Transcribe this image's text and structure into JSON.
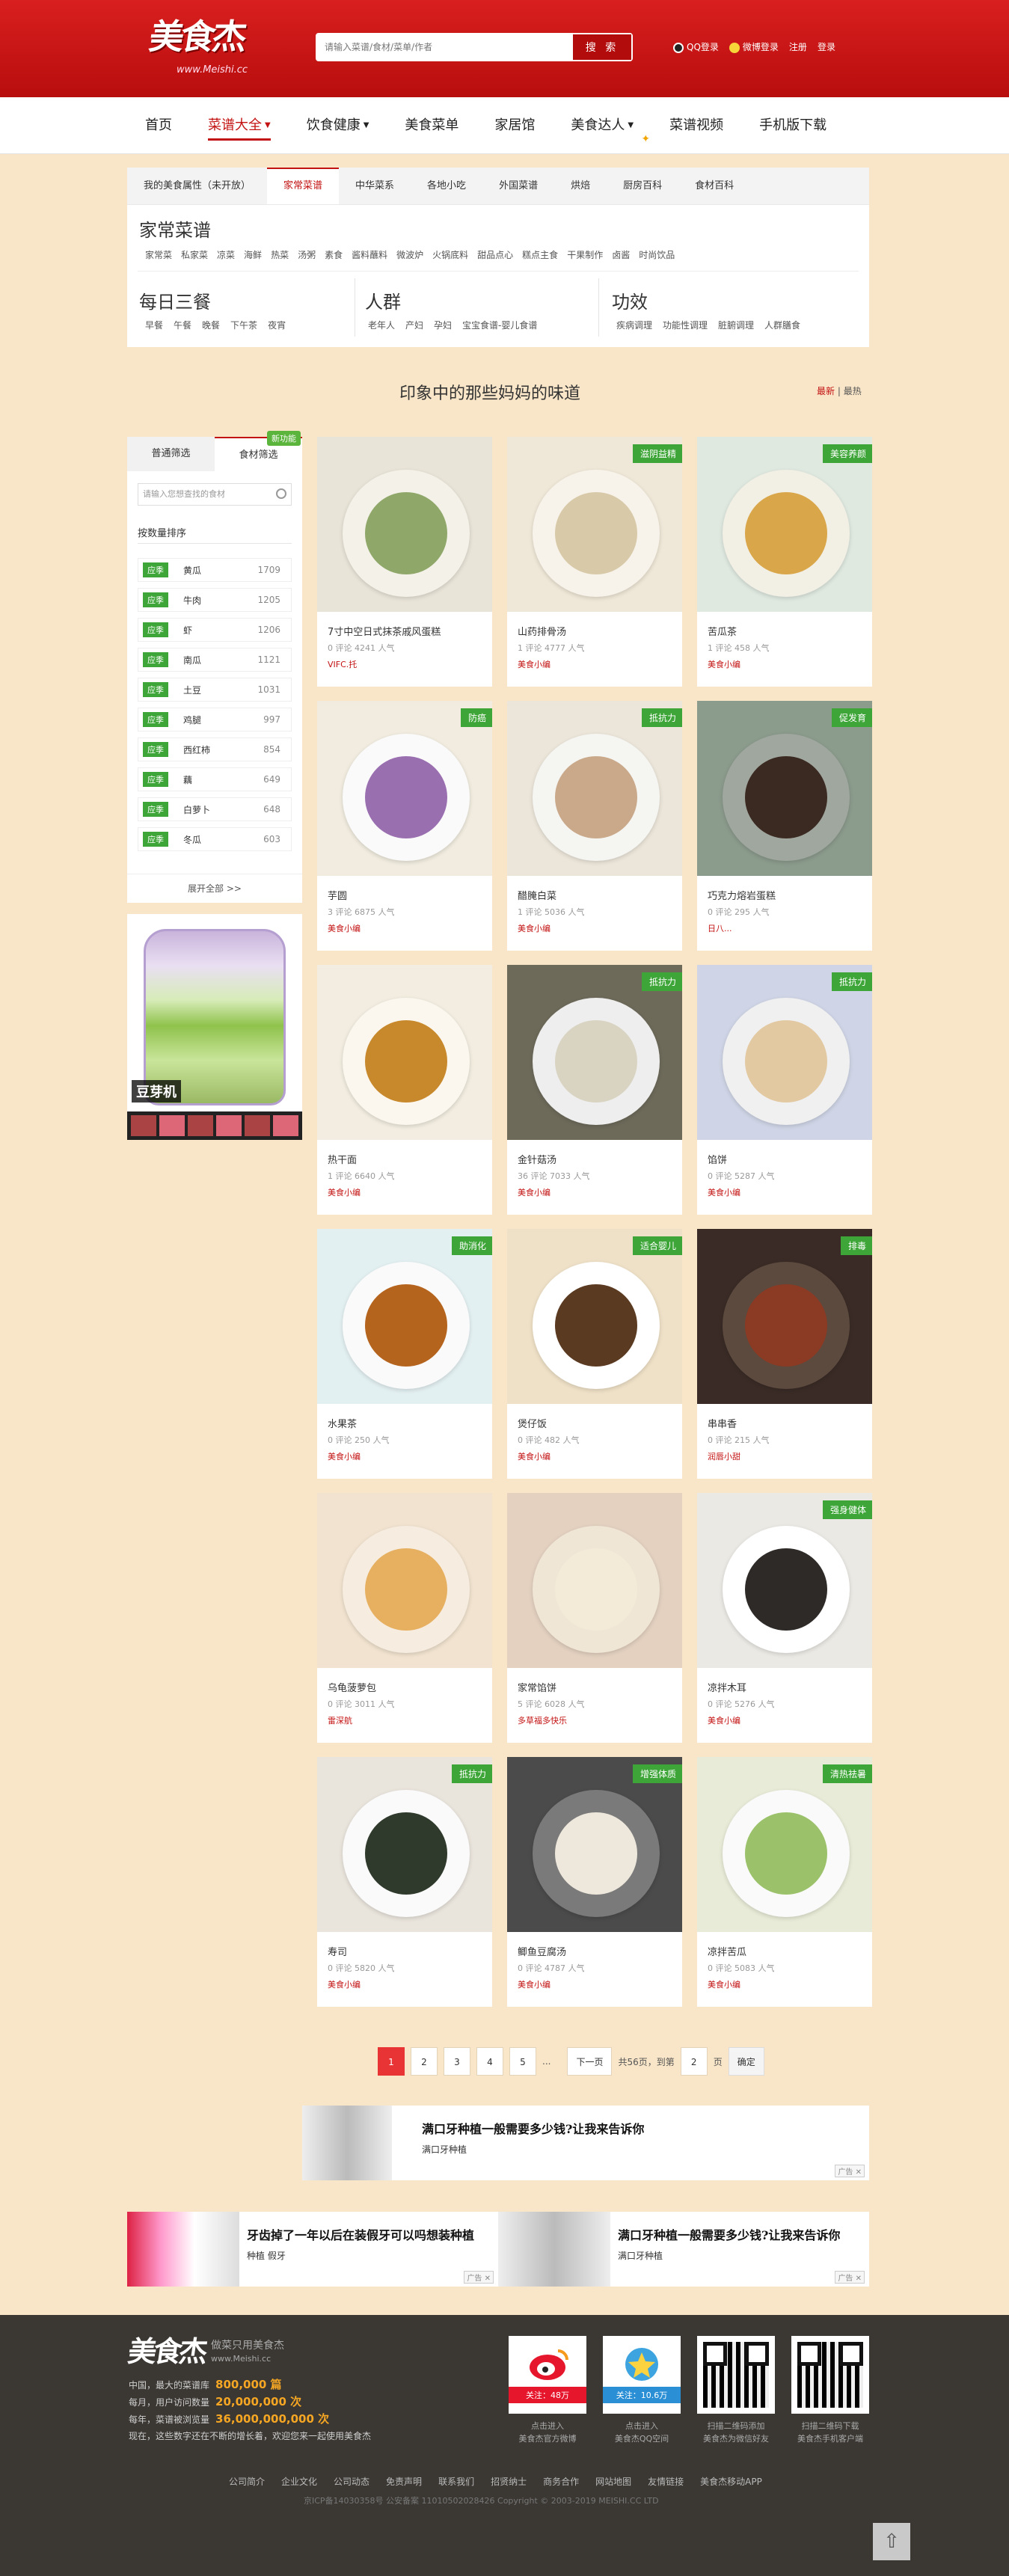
{
  "header": {
    "logo_text": "美食杰",
    "logo_url": "www.Meishi.cc",
    "search_placeholder": "请输入菜谱/食材/菜单/作者",
    "search_button": "搜 索",
    "links": [
      "QQ登录",
      "微博登录",
      "注册",
      "登录"
    ]
  },
  "nav": {
    "items": [
      "首页",
      "菜谱大全",
      "饮食健康",
      "美食菜单",
      "家居馆",
      "美食达人",
      "菜谱视频",
      "手机版下载"
    ],
    "active_index": 1
  },
  "category": {
    "tabs": [
      "我的美食属性（未开放）",
      "家常菜谱",
      "中华菜系",
      "各地小吃",
      "外国菜谱",
      "烘焙",
      "厨房百科",
      "食材百科"
    ],
    "active_tab": 1,
    "home_title": "家常菜谱",
    "home_links": [
      "家常菜",
      "私家菜",
      "凉菜",
      "海鲜",
      "热菜",
      "汤粥",
      "素食",
      "酱料蘸料",
      "微波炉",
      "火锅底料",
      "甜品点心",
      "糕点主食",
      "干果制作",
      "卤酱",
      "时尚饮品"
    ],
    "meal_title": "每日三餐",
    "meal_links": [
      "早餐",
      "午餐",
      "晚餐",
      "下午茶",
      "夜宵"
    ],
    "crowd_title": "人群",
    "crowd_links": [
      "老年人",
      "产妇",
      "孕妇",
      "宝宝食谱-婴儿食谱"
    ],
    "effect_title": "功效",
    "effect_links": [
      "疾病调理",
      "功能性调理",
      "脏腑调理",
      "人群膳食"
    ]
  },
  "section": {
    "title": "印象中的那些妈妈的味道",
    "sort_hot": "最新",
    "sort_sep": "|",
    "sort_other": "最热"
  },
  "sidebar": {
    "tabs": [
      "普通筛选",
      "食材筛选"
    ],
    "new_badge": "新功能",
    "search_placeholder": "请输入您想查找的食材",
    "sort_label": "按数量排序",
    "tag": "应季",
    "ingredients": [
      {
        "name": "黄瓜",
        "count": "1709"
      },
      {
        "name": "牛肉",
        "count": "1205"
      },
      {
        "name": "虾",
        "count": "1206"
      },
      {
        "name": "南瓜",
        "count": "1121"
      },
      {
        "name": "土豆",
        "count": "1031"
      },
      {
        "name": "鸡腿",
        "count": "997"
      },
      {
        "name": "西红柿",
        "count": "854"
      },
      {
        "name": "藕",
        "count": "649"
      },
      {
        "name": "白萝卜",
        "count": "648"
      },
      {
        "name": "冬瓜",
        "count": "603"
      }
    ],
    "expand": "展开全部 >>",
    "ad_label": "豆芽机"
  },
  "recipes": [
    {
      "title": "7寸中空日式抹茶戚风蛋糕",
      "meta": "0 评论 4241 人气",
      "author": "VIFC.托",
      "badge": ""
    },
    {
      "title": "山药排骨汤",
      "meta": "1 评论 4777 人气",
      "author": "美食小编",
      "badge": "滋阴益精"
    },
    {
      "title": "苦瓜茶",
      "meta": "1 评论 458 人气",
      "author": "美食小编",
      "badge": "美容养颜"
    },
    {
      "title": "芋圆",
      "meta": "3 评论 6875 人气",
      "author": "美食小编",
      "badge": "防癌"
    },
    {
      "title": "醋腌白菜",
      "meta": "1 评论 5036 人气",
      "author": "美食小编",
      "badge": "抵抗力"
    },
    {
      "title": "巧克力熔岩蛋糕",
      "meta": "0 评论 295 人气",
      "author": "日八...",
      "badge": "促发育"
    },
    {
      "title": "热干面",
      "meta": "1 评论 6640 人气",
      "author": "美食小编",
      "badge": ""
    },
    {
      "title": "金针菇汤",
      "meta": "36 评论 7033 人气",
      "author": "美食小编",
      "badge": "抵抗力"
    },
    {
      "title": "馅饼",
      "meta": "0 评论 5287 人气",
      "author": "美食小编",
      "badge": "抵抗力"
    },
    {
      "title": "水果茶",
      "meta": "0 评论 250 人气",
      "author": "美食小编",
      "badge": "助消化"
    },
    {
      "title": "煲仔饭",
      "meta": "0 评论 482 人气",
      "author": "美食小编",
      "badge": "适合婴儿"
    },
    {
      "title": "串串香",
      "meta": "0 评论 215 人气",
      "author": "润唇小甜",
      "badge": "排毒"
    },
    {
      "title": "乌龟菠萝包",
      "meta": "0 评论 3011 人气",
      "author": "雷深航",
      "badge": ""
    },
    {
      "title": "家常馅饼",
      "meta": "5 评论 6028 人气",
      "author": "多草福多快乐",
      "badge": ""
    },
    {
      "title": "凉拌木耳",
      "meta": "0 评论 5276 人气",
      "author": "美食小编",
      "badge": "强身健体"
    },
    {
      "title": "寿司",
      "meta": "0 评论 5820 人气",
      "author": "美食小编",
      "badge": "抵抗力"
    },
    {
      "title": "鲫鱼豆腐汤",
      "meta": "0 评论 4787 人气",
      "author": "美食小编",
      "badge": "增强体质"
    },
    {
      "title": "凉拌苦瓜",
      "meta": "0 评论 5083 人气",
      "author": "美食小编",
      "badge": "清热祛暑"
    }
  ],
  "pager": {
    "pages": [
      "1",
      "2",
      "3",
      "4",
      "5"
    ],
    "ellipsis": "...",
    "next": "下一页",
    "total": "共56页，到第",
    "current_input": "2",
    "page_unit": "页",
    "go": "确定"
  },
  "ads": [
    {
      "headline": "满口牙种植一般需要多少钱?让我来告诉你",
      "sub": "满口牙种植",
      "mark": "广告"
    },
    {
      "headline": "牙齿掉了一年以后在装假牙可以吗想装种植",
      "sub": "种植 假牙",
      "mark": "广告"
    },
    {
      "headline": "满口牙种植一般需要多少钱?让我来告诉你",
      "sub": "满口牙种植",
      "mark": "广告"
    }
  ],
  "footer": {
    "logo": "美食杰",
    "slogan": "做菜只用美食杰",
    "url": "www.Meishi.cc",
    "stats": [
      {
        "label": "中国，最大的菜谱库",
        "value": "800,000 篇"
      },
      {
        "label": "每月，用户访问数量",
        "value": "20,000,000 次"
      },
      {
        "label": "每年，菜谱被浏览量",
        "value": "36,000,000,000 次"
      }
    ],
    "invite": "现在，这些数字还在不断的增长着，欢迎您来一起使用美食杰",
    "weibo_follow": "关注：48万",
    "qzone_follow": "关注：10.6万",
    "captions": [
      "点击进入\n美食杰官方微博",
      "点击进入\n美食杰QQ空间",
      "扫描二维码添加\n美食杰为微信好友",
      "扫描二维码下载\n美食杰手机客户端"
    ],
    "links": [
      "公司简介",
      "企业文化",
      "公司动态",
      "免责声明",
      "联系我们",
      "招贤纳士",
      "商务合作",
      "网站地图",
      "友情链接",
      "美食杰移动APP"
    ],
    "copyright": "京ICP备14030358号  公安备案 11010502028426  Copyright © 2003-2019 MEISHI.CC LTD"
  }
}
